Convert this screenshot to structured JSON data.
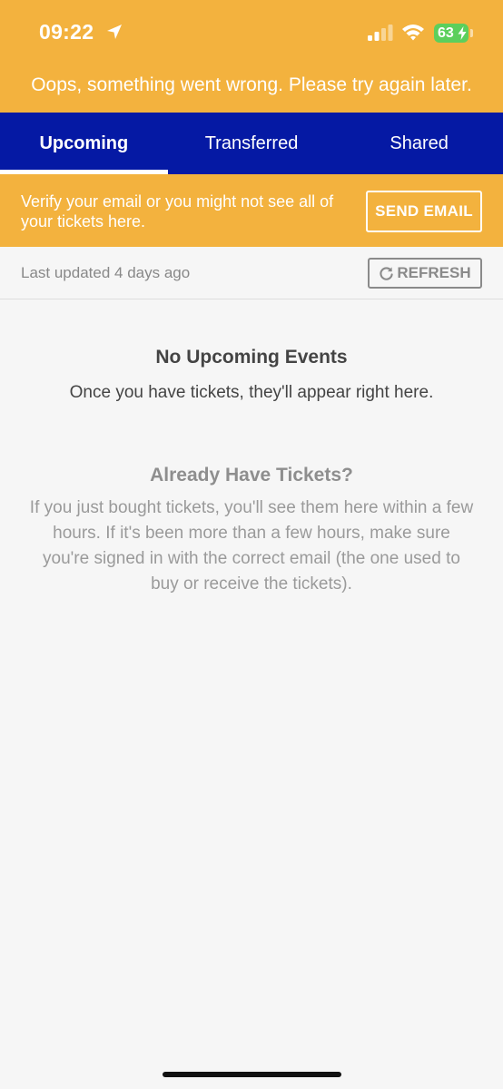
{
  "status_bar": {
    "time": "09:22",
    "battery": "63",
    "icons": [
      "location-arrow-icon",
      "signal-icon",
      "wifi-icon",
      "battery-charging-icon"
    ]
  },
  "error_banner": {
    "text": "Oops, something went wrong. Please try again later."
  },
  "tabs": [
    {
      "label": "Upcoming",
      "active": true
    },
    {
      "label": "Transferred",
      "active": false
    },
    {
      "label": "Shared",
      "active": false
    }
  ],
  "verify_banner": {
    "text": "Verify your email or you might not see all of your tickets here.",
    "button_label": "SEND EMAIL"
  },
  "updated_row": {
    "text": "Last updated 4 days ago",
    "refresh_label": "REFRESH"
  },
  "empty_state": {
    "title": "No Upcoming Events",
    "subtitle": "Once you have tickets, they'll appear right here."
  },
  "help": {
    "title": "Already Have Tickets?",
    "body": "If you just bought tickets, you'll see them here within a few hours. If it's been more than a few hours, make sure you're signed in with the correct email (the one used to buy or receive the tickets)."
  },
  "colors": {
    "accent_yellow": "#f3b23e",
    "tab_blue": "#0519a4",
    "battery_green": "#5ccf5c"
  }
}
